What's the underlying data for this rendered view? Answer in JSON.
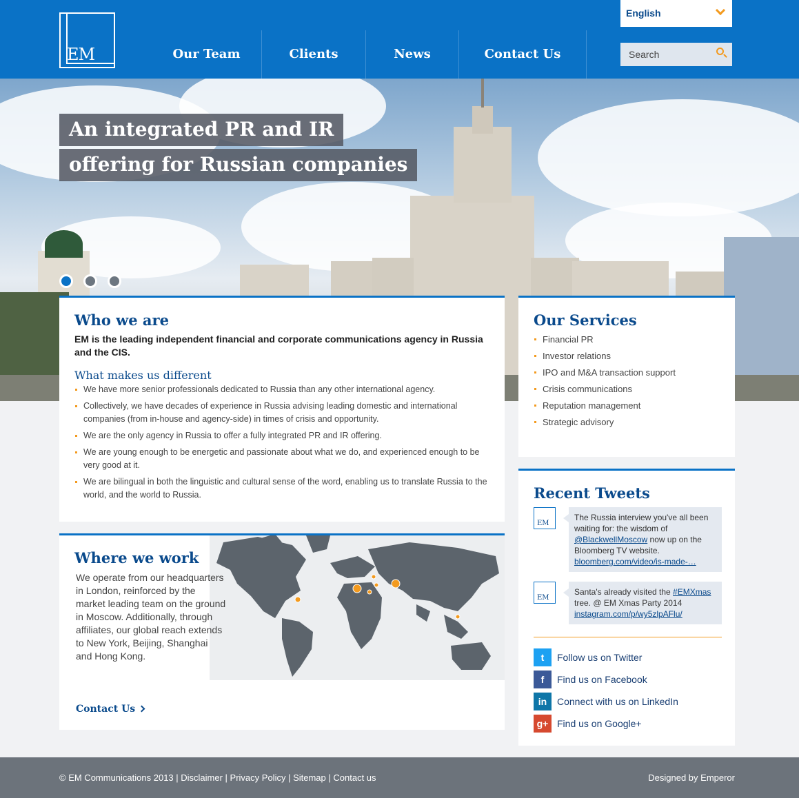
{
  "header": {
    "logo_text": "EM",
    "nav": [
      "Our Team",
      "Clients",
      "News",
      "Contact Us"
    ],
    "language": "English",
    "search_placeholder": "Search"
  },
  "hero": {
    "title_line1": "An integrated PR and IR",
    "title_line2": "offering for Russian companies",
    "slides": 3,
    "active_slide": 1
  },
  "who": {
    "title": "Who we are",
    "lead": "EM is the leading independent financial and corporate communications agency in Russia and the CIS.",
    "subtitle": "What makes us different",
    "bullets": [
      "We have more senior professionals dedicated to Russia than any other international agency.",
      "Collectively, we have decades of experience in Russia advising leading domestic and international companies (from in-house and agency-side) in times of crisis and opportunity.",
      "We are the only agency in Russia to offer a fully integrated PR and IR offering.",
      "We are young enough to be energetic and passionate about what we do, and experienced enough to be very good at it.",
      "We are bilingual in both the linguistic and cultural sense of the word, enabling us to translate Russia to the world, and the world to Russia."
    ]
  },
  "where": {
    "title": "Where we work",
    "text": "We operate from our headquarters in London, reinforced by the market leading team on the ground in Moscow.  Additionally, through affiliates, our global reach extends to New York, Beijing, Shanghai and Hong Kong.",
    "link": "Contact Us"
  },
  "services": {
    "title": "Our Services",
    "items": [
      "Financial PR",
      "Investor relations",
      "IPO and M&A transaction support",
      "Crisis communications",
      "Reputation management",
      "Strategic advisory"
    ]
  },
  "tweets": {
    "title": "Recent Tweets",
    "items": [
      {
        "text1": "The Russia interview you've all been waiting for: the wisdom of ",
        "mention": "@BlackwellMoscow",
        "text2": " now up on the Bloomberg TV website. ",
        "link": "bloomberg.com/video/is-made-…"
      },
      {
        "text1": "Santa's already visited the ",
        "mention": "#EMXmas",
        "text2": " tree. @ EM Xmas Party 2014 ",
        "link": "instagram.com/p/wy5zlpAFlu/"
      }
    ],
    "social": [
      {
        "icon": "twitter-icon",
        "label": "Follow us on Twitter",
        "color": "#1da1f2",
        "glyph": "t"
      },
      {
        "icon": "facebook-icon",
        "label": "Find us on Facebook",
        "color": "#3b5998",
        "glyph": "f"
      },
      {
        "icon": "linkedin-icon",
        "label": "Connect with us on LinkedIn",
        "color": "#0e76a8",
        "glyph": "in"
      },
      {
        "icon": "google-plus-icon",
        "label": "Find us on Google+",
        "color": "#d6492f",
        "glyph": "g+"
      }
    ]
  },
  "footer": {
    "copyright": "© EM Communications 2013",
    "links": [
      "Disclaimer",
      "Privacy Policy",
      "Sitemap",
      "Contact us"
    ],
    "credit": "Designed by Emperor"
  },
  "colors": {
    "brand_blue": "#0a72c6",
    "accent_orange": "#f39a1e",
    "footer_gray": "#6c737b"
  }
}
